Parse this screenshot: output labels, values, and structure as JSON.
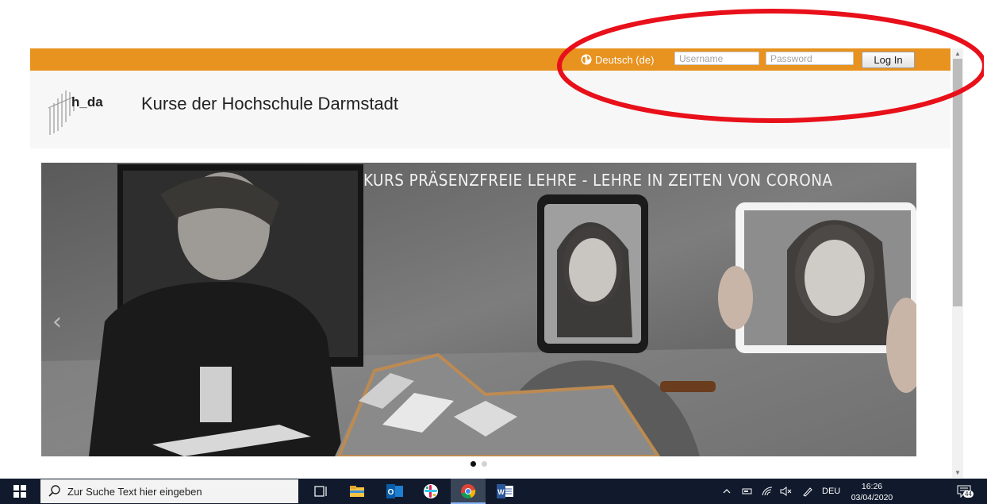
{
  "topbar": {
    "language_label": "Deutsch (de)",
    "username_placeholder": "Username",
    "password_placeholder": "Password",
    "login_label": "Log In",
    "bar_color": "#e8921f"
  },
  "header": {
    "logo_text": "h_da",
    "site_title": "Kurse der Hochschule Darmstadt"
  },
  "carousel": {
    "banner_text": "KURS PRÄSENZFREIE LEHRE - LEHRE IN ZEITEN VON CORONA",
    "prev_glyph": "‹",
    "slide_count": 2,
    "active_slide": 1
  },
  "annotation": {
    "color": "#e8101a",
    "shape": "ellipse around login area"
  },
  "taskbar": {
    "search_placeholder": "Zur Suche Text hier eingeben",
    "apps": [
      "start-icon",
      "task-view-icon",
      "file-explorer-icon",
      "outlook-icon",
      "slack-icon",
      "chrome-icon",
      "word-icon"
    ],
    "language": "DEU",
    "time": "16:26",
    "date": "03/04/2020",
    "notification_count": "44"
  }
}
